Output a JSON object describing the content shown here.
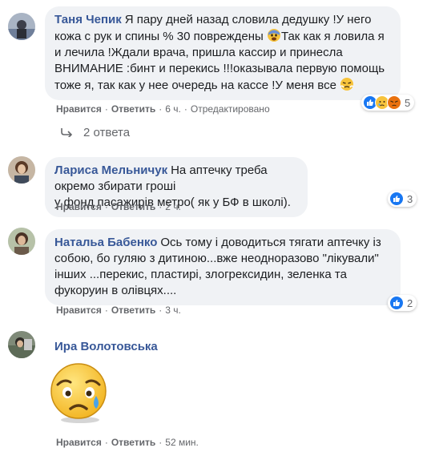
{
  "comments": [
    {
      "author": "Таня Чепик",
      "text": "Я пару дней назад словила дедушку !У него кожа с рук и спины % 30 повреждены 😰Так как я ловила я и лечила !Ждали врача, пришла кассир и принесла ВНИМАНИЕ :бинт и перекись !!!оказывала первую помощь тоже я, так как у нее очередь на кассе !У меня все 😤",
      "line1": "Я пару дней назад словила дедушку !У него",
      "line2a": "кожа с рук и спины % 30 повреждены ",
      "line2b": "Так как я ловила я",
      "line3": "и лечила !Ждали врача, пришла кассир и принесла",
      "line4": "ВНИМАНИЕ :бинт и перекись !!!оказывала первую помощь",
      "line5": "тоже я, так как у нее очередь на кассе !У меня все ",
      "like": "Нравится",
      "reply": "Ответить",
      "time": "6 ч.",
      "edited": "Отредактировано",
      "reactions_count": "5",
      "reaction_icons": [
        "like-icon",
        "sad-icon",
        "angry-icon"
      ]
    },
    {
      "author": "Лариса Мельничук",
      "line1": "На аптечку треба окремо збирати гроші",
      "line2": "у фонд пасажирів метро( як у БФ в школі).",
      "like": "Нравится",
      "reply": "Ответить",
      "time": "2 ч.",
      "reactions_count": "3",
      "reaction_icons": [
        "like-icon"
      ]
    },
    {
      "author": "Натальа Бабенко",
      "line1": "Ось тому і доводиться тягати аптечку із",
      "line2": "собою, бо гуляю з дитиною...вже неодноразово \"лікували\"",
      "line3": "інших ...перекис, пластирі, злогрексидин, зеленка та",
      "line4": "фукоруин в олівцях....",
      "like": "Нравится",
      "reply": "Ответить",
      "time": "3 ч.",
      "reactions_count": "2",
      "reaction_icons": [
        "like-icon"
      ]
    },
    {
      "author": "Ира Волотовська",
      "sticker": "crying-face-sticker",
      "like": "Нравится",
      "reply": "Ответить",
      "time": "52 мин."
    }
  ],
  "replies_link": "2 ответа",
  "colors": {
    "author": "#385898",
    "bubble": "#f0f2f5",
    "like_blue": "#1877f2",
    "meta": "#65676b"
  }
}
